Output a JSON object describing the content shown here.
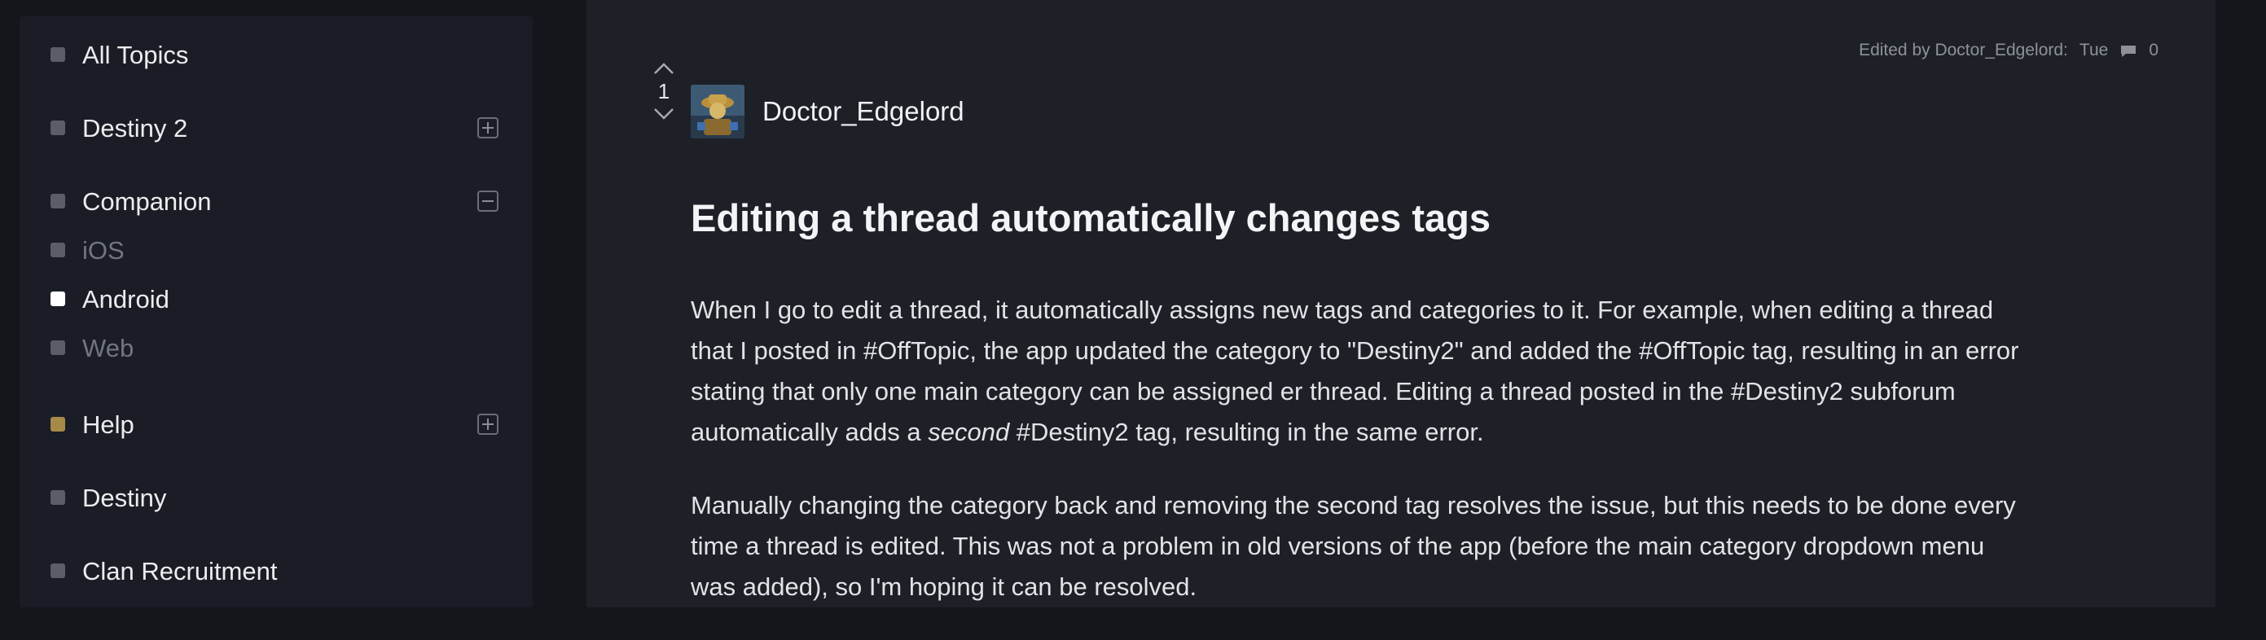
{
  "sidebar": {
    "items": [
      {
        "label": "All Topics"
      },
      {
        "label": "Destiny 2",
        "toggle": "expand"
      },
      {
        "label": "Companion",
        "toggle": "collapse"
      },
      {
        "label": "iOS"
      },
      {
        "label": "Android",
        "active": true
      },
      {
        "label": "Web"
      },
      {
        "label": "Help",
        "toggle": "expand",
        "color": "#a58a48"
      },
      {
        "label": "Destiny"
      },
      {
        "label": "Clan Recruitment"
      }
    ]
  },
  "post": {
    "edited_label": "Edited by Doctor_Edgelord:",
    "edited_time": "Tue",
    "reply_count": "0",
    "vote_count": "1",
    "author": "Doctor_Edgelord",
    "title": "Editing a thread automatically changes tags",
    "p1_a": "When I go to edit a thread, it automatically assigns new tags and categories to it. For example, when editing a thread that I posted in #OffTopic, the app updated the category to \"Destiny2\" and added the #OffTopic tag, resulting in an error stating that only one main category can be assigned er thread. Editing a thread posted in the #Destiny2 subforum automatically adds a ",
    "p1_em": "second",
    "p1_b": " #Destiny2 tag, resulting in the same error.",
    "p2": "Manually changing the category back and removing the second tag resolves the issue, but this needs to be done every time a thread is edited. This was not a problem in old versions of the app (before the main category dropdown menu was added), so I'm hoping it can be resolved."
  },
  "colors": {
    "page_bg": "#13161b",
    "sidebar_bg": "#1a1d25",
    "main_bg": "#1d2027",
    "help_category": "#a58a48"
  }
}
